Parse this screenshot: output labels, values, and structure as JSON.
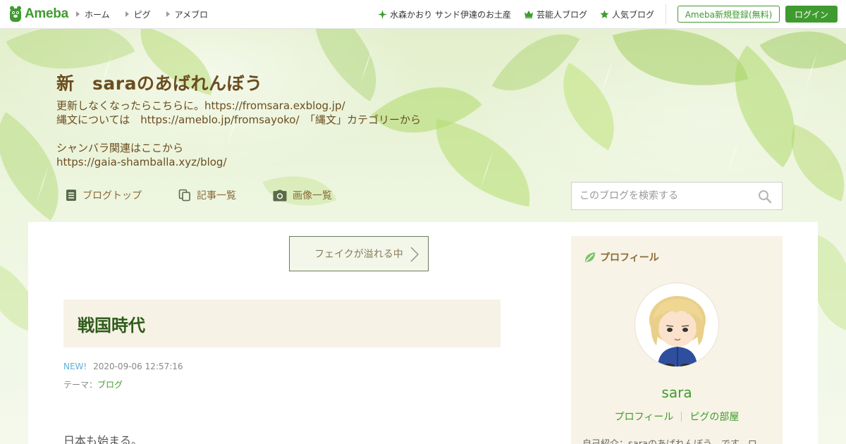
{
  "global_nav": {
    "logo_text": "Ameba",
    "left_links": [
      {
        "label": "ホーム"
      },
      {
        "label": "ピグ"
      },
      {
        "label": "アメブロ"
      }
    ],
    "right_links": [
      {
        "label": "水森かおり サンド伊達のお土産",
        "icon": "sparkle-icon"
      },
      {
        "label": "芸能人ブログ",
        "icon": "crown-icon"
      },
      {
        "label": "人気ブログ",
        "icon": "star-icon"
      }
    ],
    "register_label": "Ameba新規登録(無料)",
    "login_label": "ログイン"
  },
  "blog_header": {
    "title": "新　saraのあばれんぼう",
    "description_lines": [
      "更新しなくなったらこちらに。https://fromsara.exblog.jp/",
      "縄文については　https://ameblo.jp/fromsayoko/　「縄文」カテゴリーから",
      "",
      "シャンバラ関連はここから",
      "https://gaia-shamballa.xyz/blog/"
    ],
    "nav": [
      {
        "label": "ブログトップ",
        "icon": "document-icon"
      },
      {
        "label": "記事一覧",
        "icon": "copy-icon"
      },
      {
        "label": "画像一覧",
        "icon": "camera-icon"
      }
    ],
    "search_placeholder": "このブログを検索する"
  },
  "article": {
    "prev_link_label": "フェイクが溢れる中",
    "title": "戦国時代",
    "new_label": "NEW!",
    "datetime": "2020-09-06 12:57:16",
    "theme_prefix": "テーマ：",
    "theme": "ブログ",
    "body_first_line": "日本も始まる。"
  },
  "profile": {
    "heading": "プロフィール",
    "name": "sara",
    "links": [
      {
        "label": "プロフィール"
      },
      {
        "label": "ピグの部屋"
      }
    ],
    "intro": "自己紹介：saraのあばれんぼう　です。ロ"
  },
  "colors": {
    "brand_green": "#3f9b2f",
    "title_brown": "#6b4d1f",
    "entry_title_green": "#2e5c1a",
    "new_blue": "#5fb1d8",
    "sidebar_bg": "#f7f3e6"
  }
}
